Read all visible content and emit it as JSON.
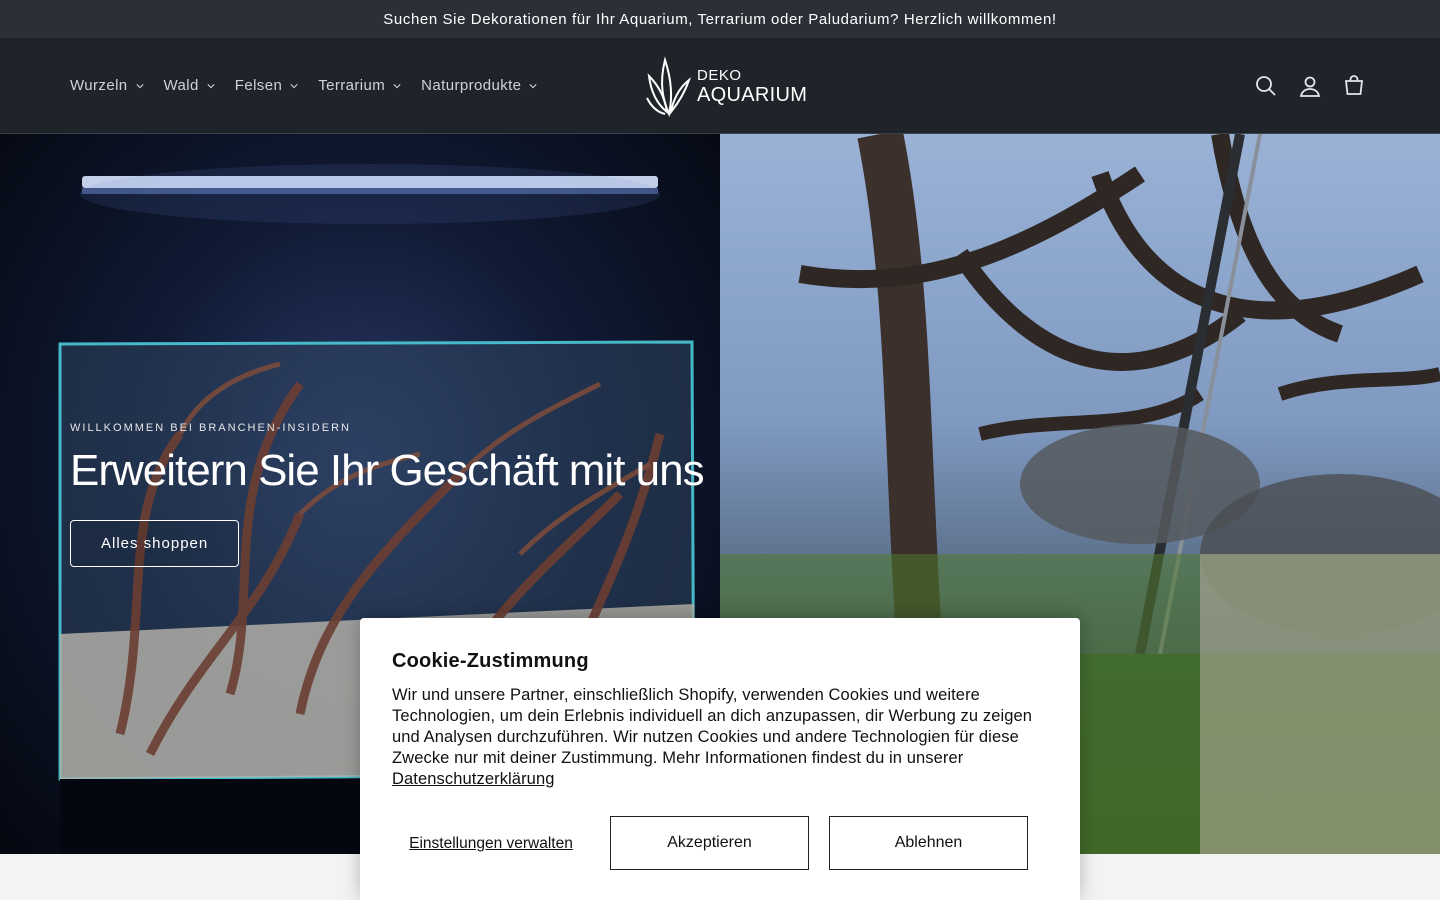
{
  "announcement": {
    "text": "Suchen Sie Dekorationen für Ihr Aquarium, Terrarium oder Paludarium? Herzlich willkommen!"
  },
  "nav": {
    "items": [
      {
        "label": "Wurzeln"
      },
      {
        "label": "Wald"
      },
      {
        "label": "Felsen"
      },
      {
        "label": "Terrarium"
      },
      {
        "label": "Naturprodukte"
      }
    ]
  },
  "logo": {
    "line1": "DEKO",
    "line2": "AQUARIUM"
  },
  "header_icons": [
    "search-icon",
    "account-icon",
    "cart-icon"
  ],
  "hero": {
    "eyebrow": "WILLKOMMEN BEI BRANCHEN-INSIDERN",
    "title": "Erweitern Sie Ihr Geschäft mit uns",
    "button": "Alles shoppen"
  },
  "cookie": {
    "title": "Cookie-Zustimmung",
    "body": "Wir und unsere Partner, einschließlich Shopify, verwenden Cookies und weitere Technologien, um dein Erlebnis individuell an dich anzupassen, dir Werbung zu zeigen und Analysen durchzuführen. Wir nutzen Cookies und andere Technologien für diese Zwecke nur mit deiner Zustimmung. Mehr Informationen findest du in unserer ",
    "link": "Datenschutzerklärung",
    "manage": "Einstellungen verwalten",
    "accept": "Akzeptieren",
    "decline": "Ablehnen"
  },
  "colors": {
    "announcement_bg": "#2b3038",
    "header_bg": "#1f242b",
    "nav_text": "#cfd3d8"
  }
}
